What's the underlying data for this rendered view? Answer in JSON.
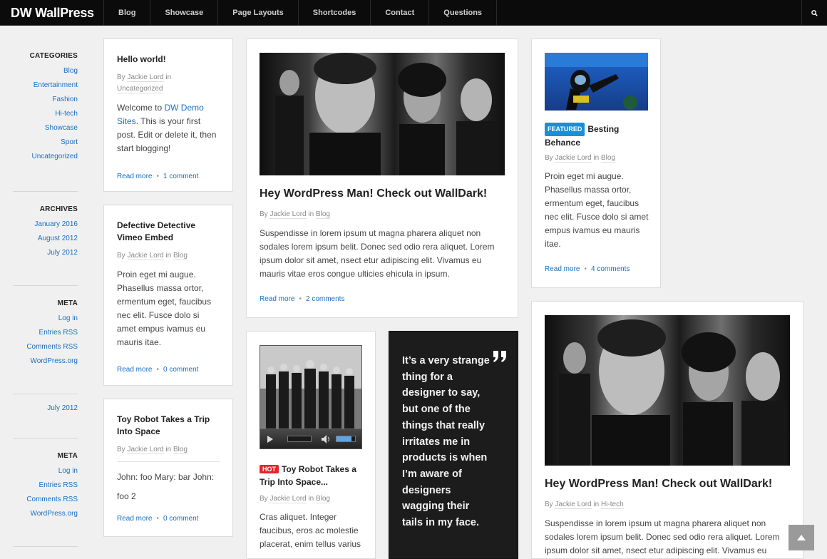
{
  "brand": "DW WallPress",
  "nav": [
    "Blog",
    "Showcase",
    "Page Layouts",
    "Shortcodes",
    "Contact",
    "Questions"
  ],
  "sidebar": {
    "categories_title": "CATEGORIES",
    "categories": [
      "Blog",
      "Entertainment",
      "Fashion",
      "Hi-tech",
      "Showcase",
      "Sport",
      "Uncategorized"
    ],
    "archives_title": "ARCHIVES",
    "archives": [
      "January 2016",
      "August 2012",
      "July 2012"
    ],
    "meta_title": "META",
    "meta": [
      "Log in",
      "Entries RSS",
      "Comments RSS",
      "WordPress.org"
    ],
    "archive_single": "July 2012",
    "meta2_title": "META",
    "meta2": [
      "Log in",
      "Entries RSS",
      "Comments RSS",
      "WordPress.org"
    ]
  },
  "posts": {
    "hello": {
      "title": "Hello world!",
      "by": "By",
      "author": "Jackie Lord",
      "in": "in",
      "cat": "Uncategorized",
      "ex1": "Welcome to ",
      "link": "DW Demo Sites",
      "ex2": ". This is your first post. Edit or delete it, then start blogging!",
      "read": "Read more",
      "dot": "•",
      "comments": "1 comment"
    },
    "defective": {
      "title": "Defective Detective Vimeo Embed",
      "by": "By",
      "author": "Jackie Lord",
      "in": "in",
      "cat": "Blog",
      "excerpt": "Proin eget mi augue. Phasellus massa ortor, ermentum eget, faucibus nec elit. Fusce dolo si amet empus ivamus eu mauris itae.",
      "read": "Read more",
      "dot": "•",
      "comments": "0 comment"
    },
    "toy1": {
      "title": "Toy Robot Takes a Trip Into Space",
      "by": "By",
      "author": "Jackie Lord",
      "in": "in",
      "cat": "Blog",
      "excerpt": "John: foo Mary: bar John: foo 2",
      "read": "Read more",
      "dot": "•",
      "comments": "0 comment"
    },
    "wp1": {
      "title": "Hey WordPress Man! Check out WallDark!",
      "by": "By",
      "author": "Jackie Lord",
      "in": "in",
      "cat": "Blog",
      "excerpt": "Suspendisse in lorem ipsum ut magna pharera aliquet non sodales lorem ipsum belit. Donec sed odio rera aliquet. Lorem ipsum dolor sit amet, nsect etur adipiscing elit. Vivamus eu mauris vitae eros congue ulticies ehicula in ipsum.",
      "read": "Read more",
      "dot": "•",
      "comments": "2 comments"
    },
    "besting": {
      "badge": "FEATURED",
      "title": "Besting Behance",
      "by": "By",
      "author": "Jackie Lord",
      "in": "in",
      "cat": "Blog",
      "excerpt": "Proin eget mi augue. Phasellus massa ortor, ermentum eget, faucibus nec elit. Fusce dolo si amet empus ivamus eu mauris itae.",
      "read": "Read more",
      "dot": "•",
      "comments": "4 comments"
    },
    "toy2": {
      "badge": "HOT",
      "title": "Toy Robot Takes a Trip Into Space...",
      "by": "By",
      "author": "Jackie Lord",
      "in": "in",
      "cat": "Blog",
      "excerpt": "Cras aliquet. Integer faucibus, eros ac molestie placerat, enim tellus varius"
    },
    "quote": {
      "text": "It’s a very strange thing for a designer to say, but one of the things that really irritates me in products is when I’m aware of designers wagging their tails in my face."
    },
    "wp2": {
      "title": "Hey WordPress Man! Check out WallDark!",
      "by": "By",
      "author": "Jackie Lord",
      "in": "in",
      "cat": "Hi-tech",
      "excerpt": "Suspendisse in lorem ipsum ut magna pharera aliquet non sodales lorem ipsum belit. Donec sed odio rera aliquet. Lorem ipsum dolor sit amet, nsect etur adipiscing elit. Vivamus eu"
    }
  },
  "colors": {
    "topbar": "#0b0b0b",
    "link": "#1a6fc4",
    "featured": "#1a8fd6",
    "hot": "#e0262b",
    "quote_bg": "#1c1c1c"
  }
}
